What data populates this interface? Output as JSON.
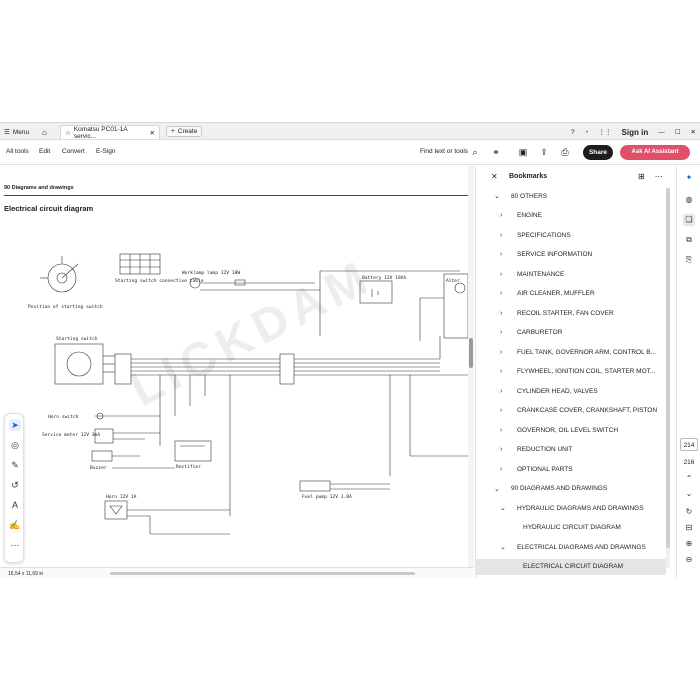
{
  "tabbar": {
    "menu_label": "Menu",
    "doc_tab_label": "Komatsu PC01-1A servic...",
    "create_label": "Create",
    "signin_label": "Sign in"
  },
  "toolbar": {
    "all_tools": "All tools",
    "edit": "Edit",
    "convert": "Convert",
    "esign": "E-Sign",
    "find": "Find text or tools",
    "share": "Share",
    "ai_assistant": "Ask AI Assistant"
  },
  "document": {
    "header": "90 Diagrams and drawings",
    "title": "Electrical circuit diagram",
    "diagram_labels": {
      "start_pos": "Position of starting switch",
      "start_table": "Starting switch connective table",
      "worklamp": "Worklamp lamp 12V 18W",
      "battery": "Battery 12V 18Ah",
      "alternator": "Alter",
      "start_switch": "Starting switch",
      "horn_switch": "Horn switch",
      "service_meter": "Service meter 12V 3mA",
      "buzzer": "Buzzer",
      "rectifier": "Rectifier",
      "horn": "Horn 12V 1A",
      "fuel_pump": "Fuel pump 12V 1.0A"
    },
    "watermark": "LICKDAM"
  },
  "statusbar": {
    "dims": "16,54 x 11,69 in"
  },
  "bookmarks": {
    "title": "Bookmarks",
    "items": [
      {
        "label": "80 OTHERS",
        "level": 0,
        "expanded": true
      },
      {
        "label": "ENGINE",
        "level": 1,
        "expanded": false
      },
      {
        "label": "SPECIFICATIONS",
        "level": 1,
        "expanded": false
      },
      {
        "label": "SERVICE INFORMATION",
        "level": 1,
        "expanded": false
      },
      {
        "label": "MAINTENANCE",
        "level": 1,
        "expanded": false
      },
      {
        "label": "AIR CLEANER, MUFFLER",
        "level": 1,
        "expanded": false
      },
      {
        "label": "RECOIL STARTER, FAN COVER",
        "level": 1,
        "expanded": false
      },
      {
        "label": "CARBURETOR",
        "level": 1,
        "expanded": false
      },
      {
        "label": "FUEL TANK, GOVERNOR ARM, CONTROL B...",
        "level": 1,
        "expanded": false
      },
      {
        "label": "FLYWHEEL, IGNITION COIL, STARTER MOT...",
        "level": 1,
        "expanded": false
      },
      {
        "label": "CYLINDER HEAD, VALVES",
        "level": 1,
        "expanded": false
      },
      {
        "label": "CRANKCASE COVER, CRANKSHAFT, PISTON",
        "level": 1,
        "expanded": false
      },
      {
        "label": "GOVERNOR, OIL LEVEL SWITCH",
        "level": 1,
        "expanded": false
      },
      {
        "label": "REDUCTION UNIT",
        "level": 1,
        "expanded": false
      },
      {
        "label": "OPTIONAL PARTS",
        "level": 1,
        "expanded": false
      },
      {
        "label": "90 DIAGRAMS AND DRAWINGS",
        "level": 0,
        "expanded": true
      },
      {
        "label": "HYDRAULIC DIAGRAMS AND DRAWINGS",
        "level": 1,
        "expanded": true
      },
      {
        "label": "HYDRAULIC CIRCUIT DIAGRAM",
        "level": 2,
        "expanded": false
      },
      {
        "label": "ELECTRICAL DIAGRAMS AND DRAWINGS",
        "level": 1,
        "expanded": true
      },
      {
        "label": "ELECTRICAL CIRCUIT DIAGRAM",
        "level": 2,
        "expanded": false
      }
    ]
  },
  "rail": {
    "page_current": "214",
    "page_total": "216"
  }
}
